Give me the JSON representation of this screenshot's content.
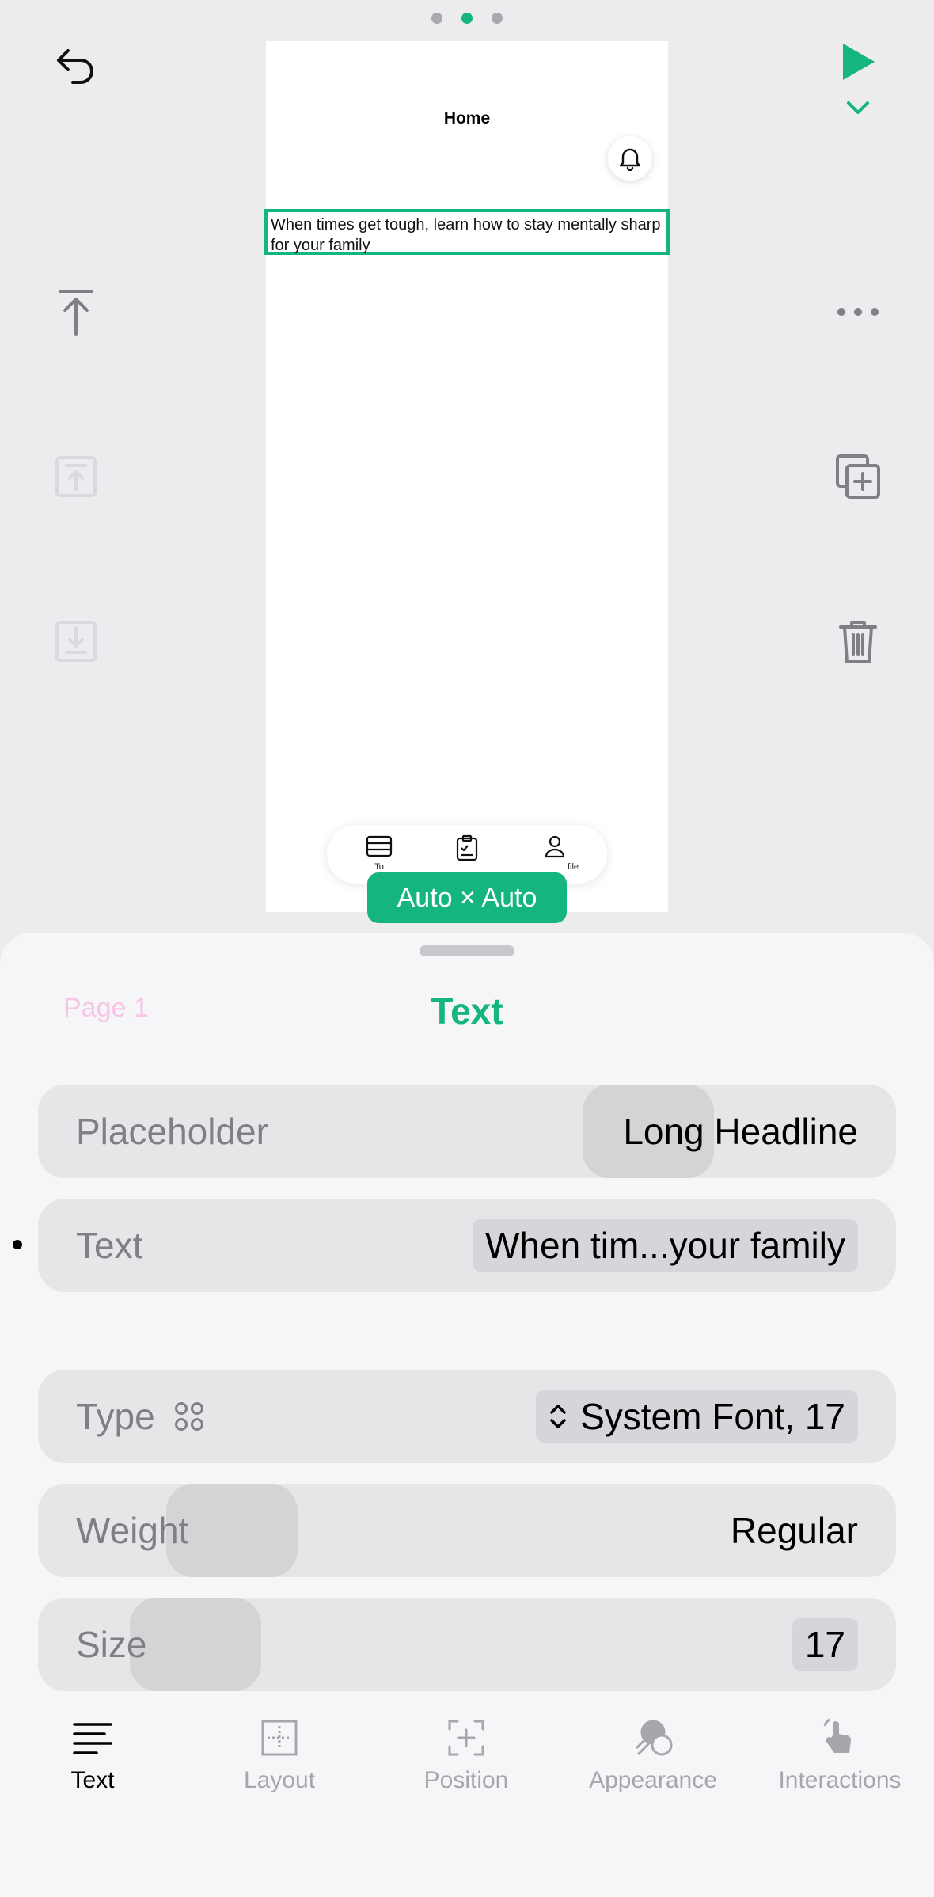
{
  "colors": {
    "accent": "#14b57e",
    "breadcrumb": "#f7c6e6"
  },
  "pager": {
    "count": 3,
    "active_index": 1
  },
  "toolbar": {
    "undo_icon": "undo-arrow-icon",
    "play_icon": "play-icon",
    "chevron_icon": "chevron-down-icon",
    "move_to_top_icon": "move-to-top-icon",
    "more_icon": "more-horizontal-icon",
    "bring_forward_icon": "bring-forward-icon",
    "duplicate_icon": "duplicate-icon",
    "send_backward_icon": "send-backward-icon",
    "delete_icon": "trash-icon"
  },
  "canvas": {
    "title": "Home",
    "selected_text": "When times get tough, learn how to stay mentally sharp for your family",
    "mini_tabs": [
      {
        "label": "To",
        "icon": "list-icon"
      },
      {
        "label": "",
        "icon": "clipboard-check-icon"
      },
      {
        "label": "file",
        "icon": "person-icon"
      }
    ]
  },
  "size_badge": "Auto × Auto",
  "sheet": {
    "breadcrumb": "Page 1",
    "title": "Text",
    "rows": [
      {
        "label": "Placeholder",
        "value": "Long Headline"
      },
      {
        "label": "Text",
        "value": "When tim...your family"
      },
      {
        "label": "Type",
        "value": "System Font, 17"
      },
      {
        "label": "Weight",
        "value": "Regular"
      },
      {
        "label": "Size",
        "value": "17"
      }
    ]
  },
  "tabs": [
    {
      "label": "Text",
      "icon": "text-align-icon",
      "active": true
    },
    {
      "label": "Layout",
      "icon": "layout-icon",
      "active": false
    },
    {
      "label": "Position",
      "icon": "position-icon",
      "active": false
    },
    {
      "label": "Appearance",
      "icon": "appearance-icon",
      "active": false
    },
    {
      "label": "Interactions",
      "icon": "tap-hand-icon",
      "active": false
    }
  ]
}
